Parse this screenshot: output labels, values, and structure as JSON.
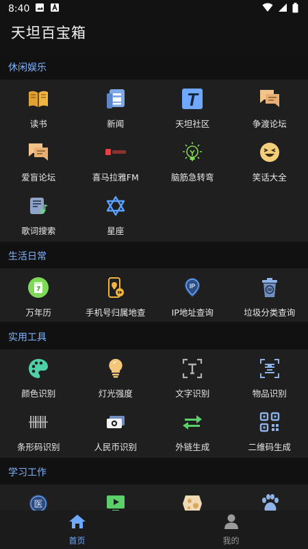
{
  "status": {
    "time": "8:40",
    "icons": [
      "image-icon",
      "a-letter-icon"
    ],
    "right_icons": [
      "wifi-icon",
      "signal-icon",
      "battery-icon"
    ]
  },
  "app": {
    "title": "天坦百宝箱"
  },
  "sections": [
    {
      "title": "休闲娱乐",
      "items": [
        {
          "label": "读书",
          "icon": "book-icon"
        },
        {
          "label": "新闻",
          "icon": "news-icon"
        },
        {
          "label": "天坦社区",
          "icon": "community-t-icon"
        },
        {
          "label": "争渡论坛",
          "icon": "chat-forum-icon"
        },
        {
          "label": "爱盲论坛",
          "icon": "chat-forum-icon"
        },
        {
          "label": "喜马拉雅FM",
          "icon": "ximalaya-logo-icon"
        },
        {
          "label": "脑筋急转弯",
          "icon": "lightbulb-icon"
        },
        {
          "label": "笑话大全",
          "icon": "laughing-face-icon"
        },
        {
          "label": "歌词搜索",
          "icon": "music-scroll-icon"
        },
        {
          "label": "星座",
          "icon": "star-of-david-icon"
        }
      ]
    },
    {
      "title": "生活日常",
      "items": [
        {
          "label": "万年历",
          "icon": "calendar-icon"
        },
        {
          "label": "手机号归属地查",
          "icon": "phone-location-icon"
        },
        {
          "label": "IP地址查询",
          "icon": "ip-pin-icon"
        },
        {
          "label": "垃圾分类查询",
          "icon": "trash-bin-icon"
        }
      ]
    },
    {
      "title": "实用工具",
      "items": [
        {
          "label": "颜色识别",
          "icon": "palette-icon"
        },
        {
          "label": "灯光强度",
          "icon": "bulb-icon"
        },
        {
          "label": "文字识别",
          "icon": "text-scan-icon"
        },
        {
          "label": "物品识别",
          "icon": "object-scan-icon"
        },
        {
          "label": "条形码识别",
          "icon": "barcode-icon"
        },
        {
          "label": "人民币识别",
          "icon": "banknote-icon"
        },
        {
          "label": "外链生成",
          "icon": "swap-arrows-icon"
        },
        {
          "label": "二维码生成",
          "icon": "qr-code-icon"
        }
      ]
    },
    {
      "title": "学习工作",
      "items": [
        {
          "label": "",
          "icon": "medical-icon",
          "glyph": "医"
        },
        {
          "label": "",
          "icon": "video-play-icon"
        },
        {
          "label": "",
          "icon": "map-pattern-icon"
        },
        {
          "label": "",
          "icon": "paw-icon"
        }
      ]
    }
  ],
  "bottom_nav": [
    {
      "label": "首页",
      "icon": "home-icon",
      "active": true
    },
    {
      "label": "我的",
      "icon": "user-icon",
      "active": false
    }
  ],
  "colors": {
    "accent": "#6fa8ff",
    "inactive": "#9a9a9a",
    "section_text": "#7fb3ff"
  }
}
